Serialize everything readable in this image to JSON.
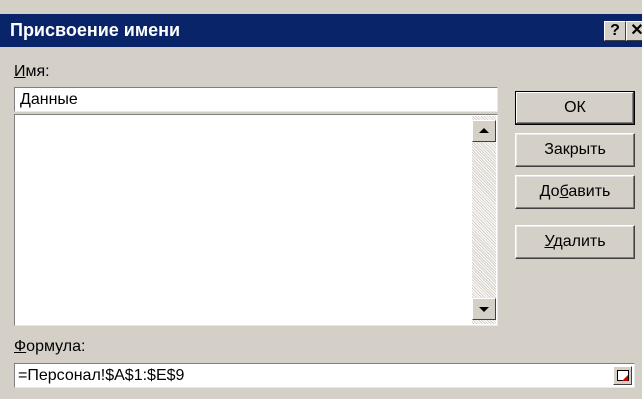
{
  "dialog": {
    "title": "Присвоение имени",
    "help_label": "?",
    "close_label": "✕"
  },
  "name": {
    "label_underlined": "И",
    "label_rest": "мя:",
    "value": "Данные"
  },
  "list": {
    "items": []
  },
  "buttons": {
    "ok": "ОК",
    "close": "Закрыть",
    "add_before": "До",
    "add_underlined": "б",
    "add_after": "авить",
    "delete_underlined": "У",
    "delete_rest": "далить"
  },
  "formula": {
    "label_underlined": "Ф",
    "label_rest": "ормула:",
    "value": "=Персонал!$A$1:$E$9"
  },
  "colors": {
    "title_bar": "#0a246a",
    "face": "#d4d0c8"
  }
}
